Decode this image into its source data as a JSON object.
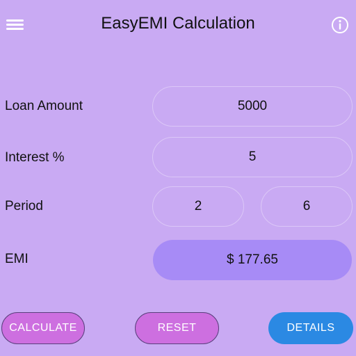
{
  "header": {
    "title": "EasyEMI Calculation",
    "menu_icon": "hamburger-menu-icon",
    "info_icon": "info-circle-icon"
  },
  "form": {
    "loan_amount": {
      "label": "Loan Amount",
      "value": "5000"
    },
    "interest": {
      "label": "Interest %",
      "value": "5"
    },
    "period": {
      "label": "Period",
      "years": "2",
      "months": "6"
    },
    "emi": {
      "label": "EMI",
      "value": "$ 177.65"
    }
  },
  "buttons": {
    "calculate": "CALCULATE",
    "reset": "RESET",
    "details": "DETAILS"
  },
  "colors": {
    "background": "#c9aaf3",
    "emi_fill": "#a78bf6",
    "primary_button": "#cd6fe0",
    "details_button": "#2b89e3"
  }
}
